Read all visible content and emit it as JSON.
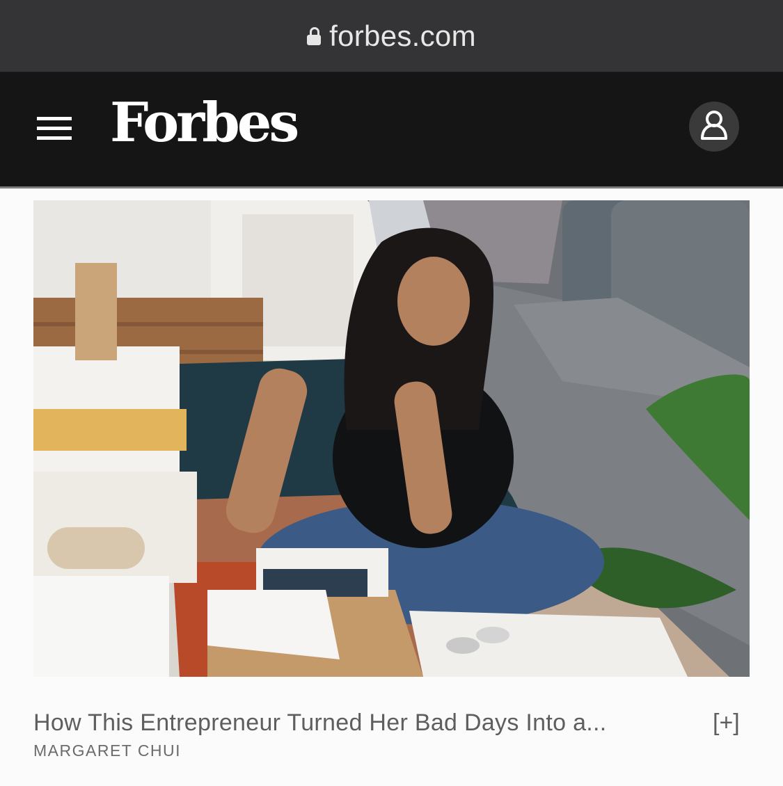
{
  "browser": {
    "url": "forbes.com"
  },
  "header": {
    "logo": "Forbes",
    "menu_icon": "hamburger-icon",
    "user_icon": "user-icon"
  },
  "article": {
    "image_alt": "Woman sitting on a rug packing a gift box beside a gray sofa",
    "headline": "How This Entrepreneur Turned Her Bad Days Into a...",
    "expand_label": "[+]",
    "byline": "MARGARET CHUI"
  },
  "colors": {
    "url_bar": "#343436",
    "header_bg": "#161515",
    "text_secondary": "#5e5e5e"
  }
}
